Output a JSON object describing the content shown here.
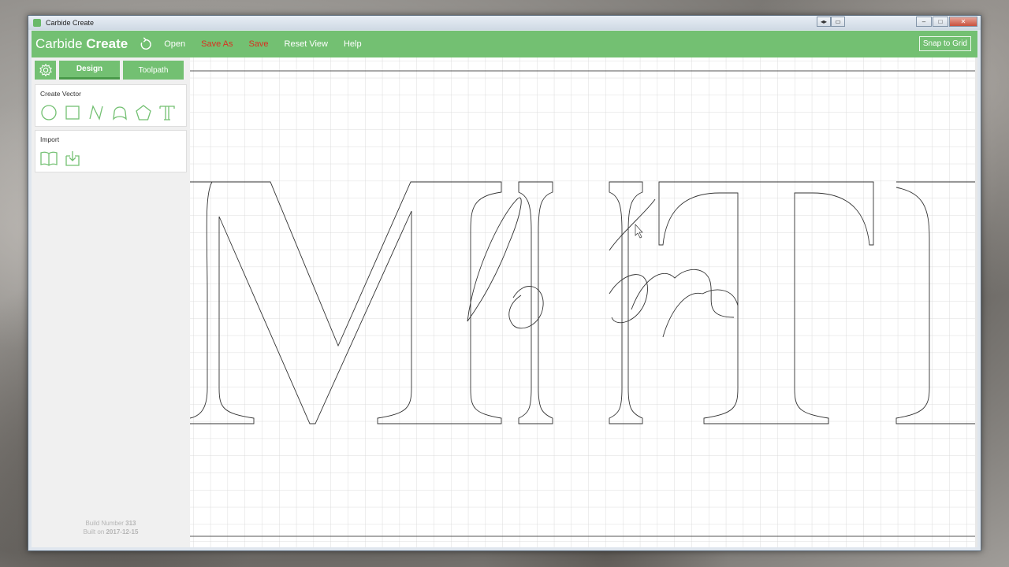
{
  "window": {
    "title": "Carbide Create",
    "min_label": "–",
    "max_label": "□",
    "close_label": "✕",
    "extra_btn_1": "◂▸",
    "extra_btn_2": "▭"
  },
  "topbar": {
    "brand_light": "Carbide ",
    "brand_bold": "Create",
    "menu": [
      "Open",
      "Save As",
      "Save",
      "Reset View",
      "Help"
    ],
    "snap_label": "Snap to Grid"
  },
  "sidebar": {
    "tabs": [
      "Design",
      "Toolpath"
    ],
    "create_vector_title": "Create Vector",
    "create_vector_tools": [
      "circle-icon",
      "rectangle-icon",
      "polyline-icon",
      "curve-icon",
      "polygon-icon",
      "text-icon"
    ],
    "import_title": "Import",
    "import_tools": [
      "book-icon",
      "import-download-icon"
    ],
    "build_number_label": "Build Number ",
    "build_number": "313",
    "built_on_label": "Built on ",
    "built_on": "2017-12-15"
  },
  "colors": {
    "accent": "#73c072",
    "save_red": "#d93020",
    "grid": "#d4d4d4"
  }
}
